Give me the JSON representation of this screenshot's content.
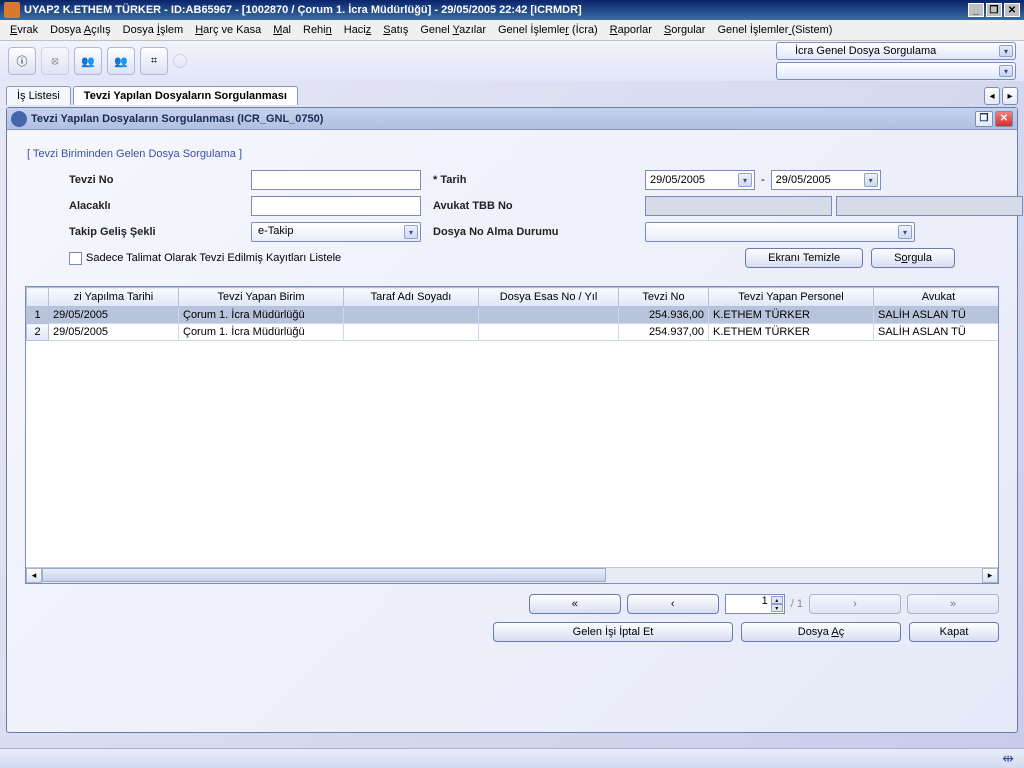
{
  "titlebar": "UYAP2   K.ETHEM TÜRKER - ID:AB65967 - [1002870 / Çorum 1. İcra Müdürlüğü] - 29/05/2005 22:42 [ICRMDR]",
  "menus": [
    "Evrak",
    "Dosya Açılış",
    "Dosya İşlem",
    "Harç ve Kasa",
    "Mal",
    "Rehin",
    "Haciz",
    "Satış",
    "Genel Yazılar",
    "Genel İşlemler (İcra)",
    "Raporlar",
    "Sorgular",
    "Genel İşlemler (Sistem)"
  ],
  "menu_underline_index": [
    0,
    6,
    6,
    0,
    0,
    4,
    4,
    0,
    6,
    13,
    0,
    0,
    14
  ],
  "top_combo1": "İcra Genel Dosya Sorgulama",
  "tabs": {
    "t1": "İş Listesi",
    "t2": "Tevzi Yapılan Dosyaların Sorgulanması"
  },
  "inner_title": "Tevzi Yapılan Dosyaların Sorgulanması (ICR_GNL_0750)",
  "fieldset": "[ Tevzi Biriminden Gelen Dosya Sorgulama ]",
  "labels": {
    "tevzi_no": "Tevzi No",
    "tarih": "* Tarih",
    "alacakli": "Alacaklı",
    "avukat_tbb": "Avukat TBB No",
    "takip_gelis": "Takip Geliş Şekli",
    "dosya_no_alma": "Dosya No Alma Durumu",
    "checkbox": "Sadece Talimat Olarak Tevzi Edilmiş Kayıtları Listele"
  },
  "values": {
    "tarih1": "29/05/2005",
    "tarih2": "29/05/2005",
    "takip_gelis": "e-Takip"
  },
  "buttons": {
    "ekrani_temizle": "Ekranı Temizle",
    "sorgula": "Sorgula",
    "gelen_isi_iptal": "Gelen İşi İptal Et",
    "dosya_ac": "Dosya Aç",
    "kapat": "Kapat"
  },
  "pager": {
    "current": "1",
    "total": "/ 1"
  },
  "columns": [
    "zi Yapılma Tarihi",
    "Tevzi Yapan Birim",
    "Taraf Adı Soyadı",
    "Dosya Esas No / Yıl",
    "Tevzi No",
    "Tevzi Yapan Personel",
    "Avukat"
  ],
  "rows": [
    {
      "n": "1",
      "c0": "29/05/2005",
      "c1": "Çorum 1. İcra Müdürlüğü",
      "c2": "",
      "c3": "",
      "c4": "254.936,00",
      "c5": "K.ETHEM TÜRKER",
      "c6": "SALİH ASLAN TÜ"
    },
    {
      "n": "2",
      "c0": "29/05/2005",
      "c1": "Çorum 1. İcra Müdürlüğü",
      "c2": "",
      "c3": "",
      "c4": "254.937,00",
      "c5": "K.ETHEM TÜRKER",
      "c6": "SALİH ASLAN TÜ"
    }
  ]
}
